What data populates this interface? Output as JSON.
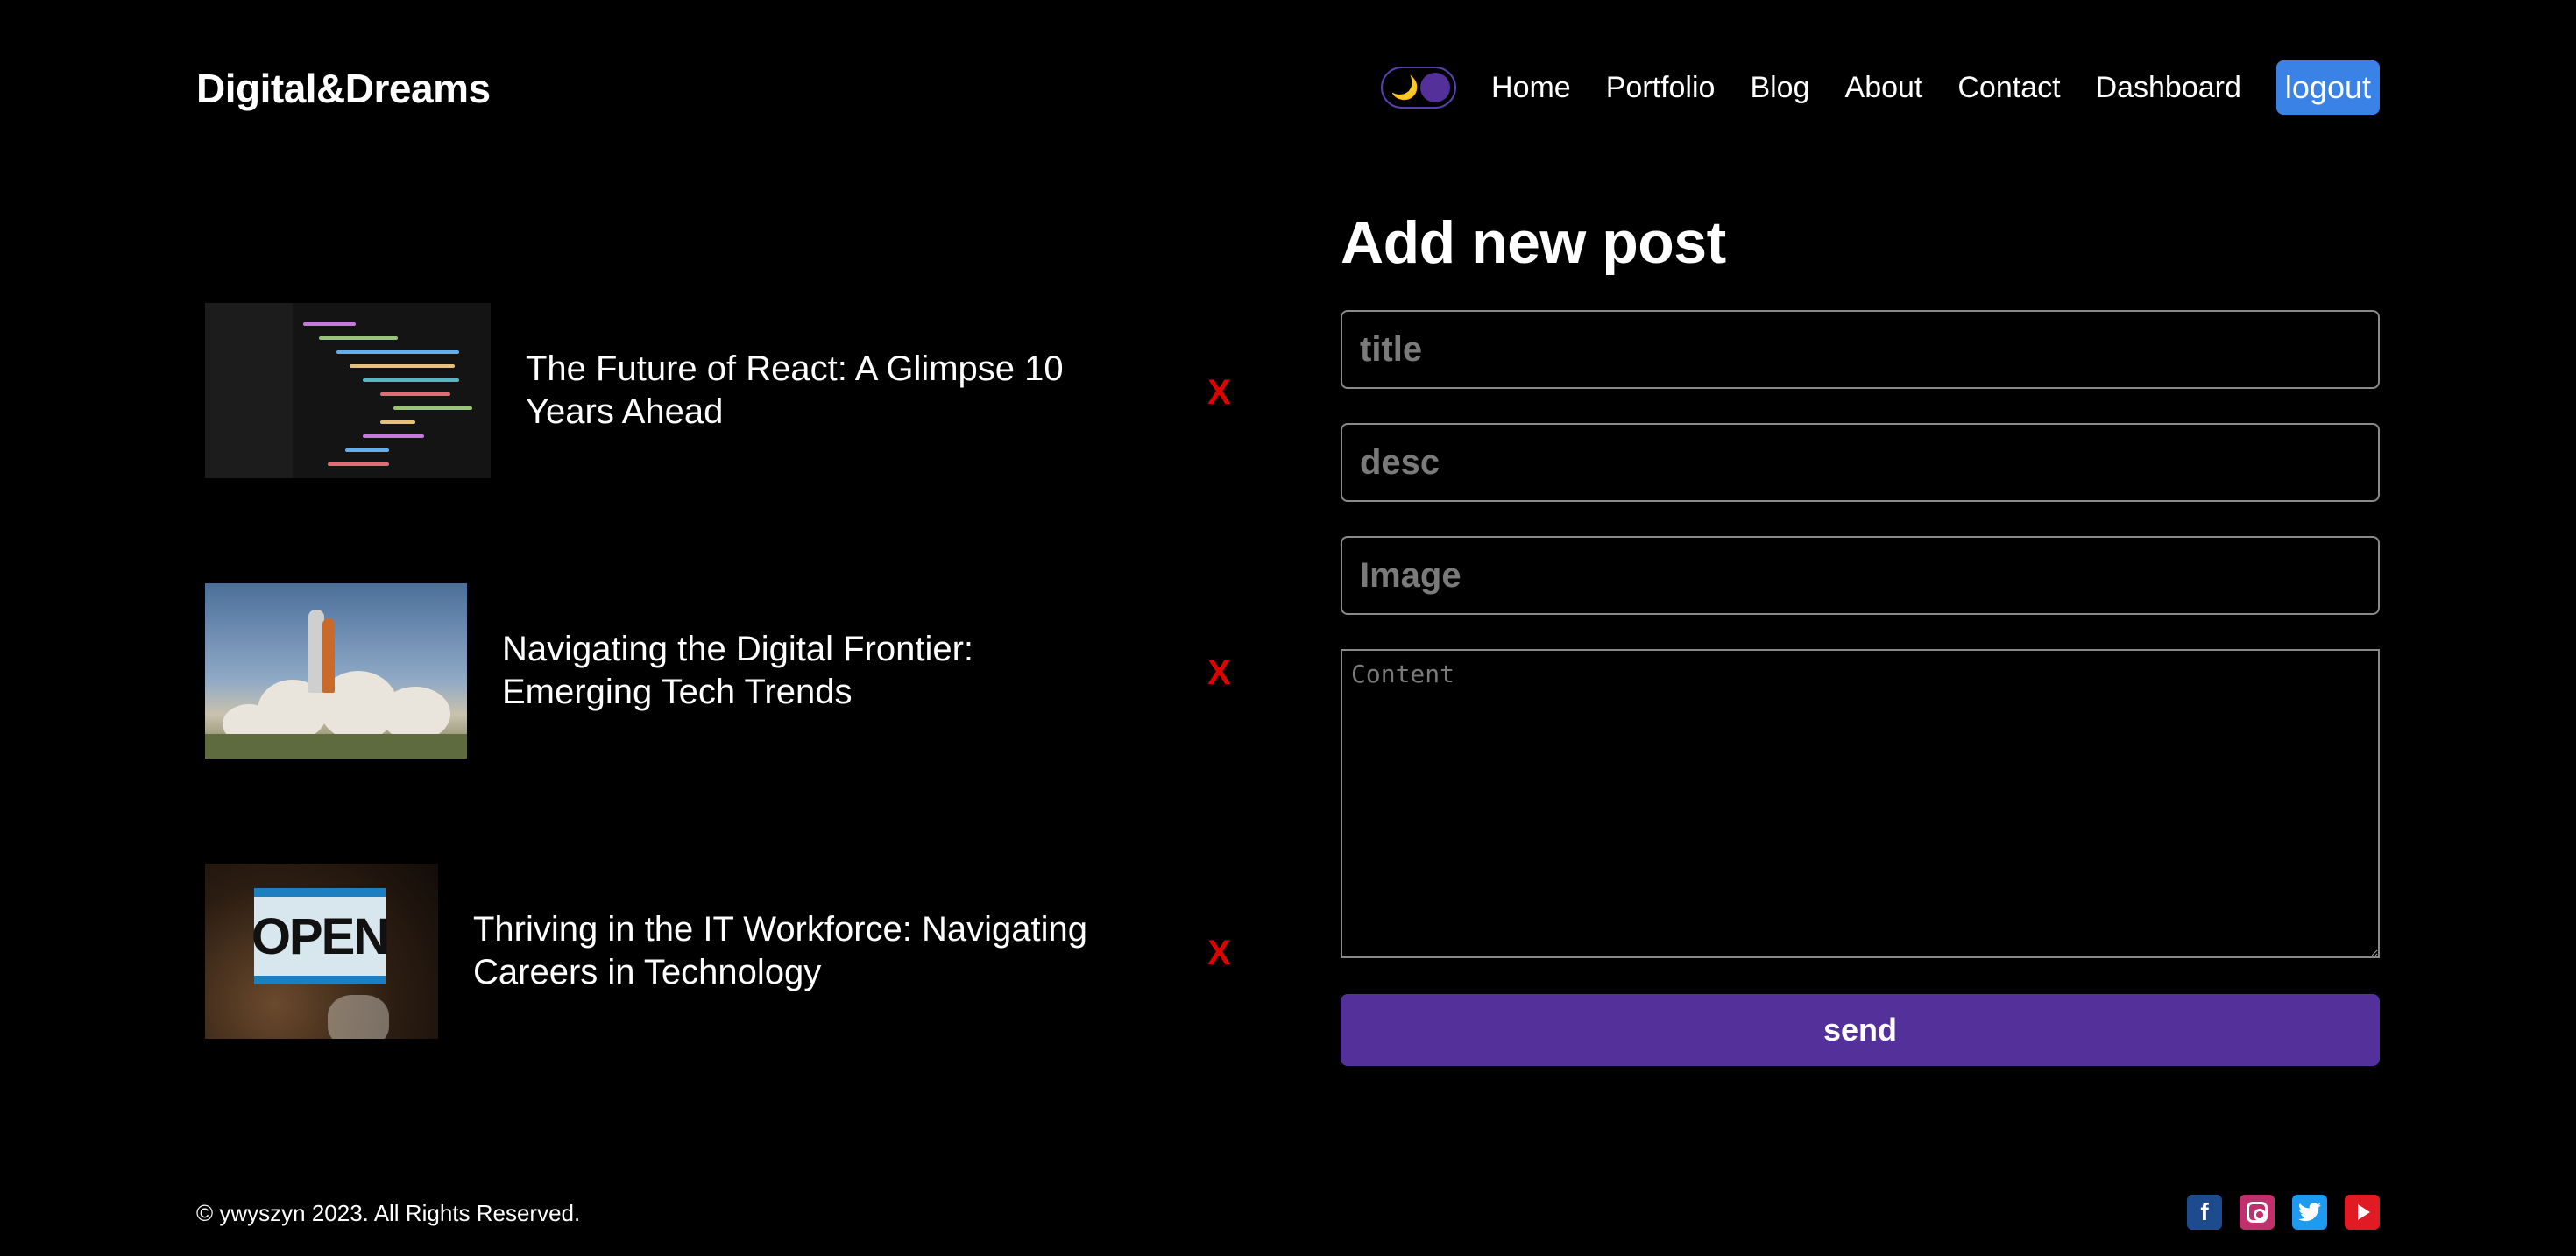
{
  "header": {
    "logo": "Digital&Dreams",
    "theme_toggle": {
      "moon_icon": "🌙"
    },
    "nav": [
      "Home",
      "Portfolio",
      "Blog",
      "About",
      "Contact",
      "Dashboard"
    ],
    "logout_label": "logout"
  },
  "posts": [
    {
      "title": "The Future of React: A Glimpse 10 Years Ahead",
      "image": "code-screen",
      "delete_label": "X"
    },
    {
      "title": "Navigating the Digital Frontier: Emerging Tech Trends",
      "image": "shuttle-launch",
      "delete_label": "X"
    },
    {
      "title": "Thriving in the IT Workforce: Navigating Careers in Technology",
      "image": "open-sign",
      "open_sign_text": "OPEN",
      "delete_label": "X"
    }
  ],
  "form": {
    "heading": "Add new post",
    "title_placeholder": "title",
    "desc_placeholder": "desc",
    "image_placeholder": "Image",
    "content_placeholder": "Content",
    "send_label": "send"
  },
  "footer": {
    "copyright": "© ywyszyn 2023. All Rights Reserved.",
    "socials": [
      "facebook",
      "instagram",
      "twitter",
      "youtube"
    ]
  },
  "colors": {
    "accent_purple": "#53309a",
    "logout_blue": "#3b82e6",
    "delete_red": "#e00000"
  }
}
